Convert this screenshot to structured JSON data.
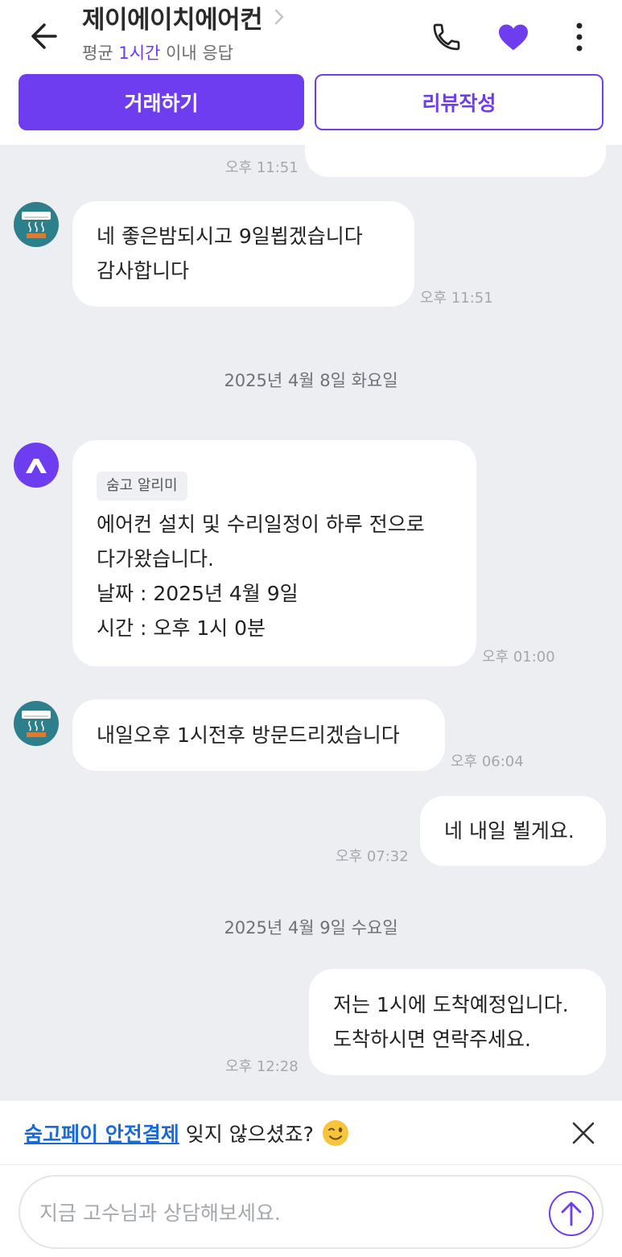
{
  "header": {
    "title": "제이에이치에어컨",
    "subtitle_prefix": "평균 ",
    "subtitle_accent": "1시간",
    "subtitle_suffix": " 이내 응답",
    "deal_button": "거래하기",
    "review_button": "리뷰작성"
  },
  "colors": {
    "accent": "#6f3df0",
    "link": "#1a6ad6",
    "chat_background": "#eceef1"
  },
  "icons": {
    "back": "back-arrow-icon",
    "chevron": "chevron-right-icon",
    "phone": "phone-icon",
    "favorite": "heart-icon",
    "more": "more-vertical-icon",
    "close": "close-icon",
    "send": "send-arrow-icon"
  },
  "messages": {
    "m0": {
      "time": "오후 11:51"
    },
    "m1": {
      "lines": [
        "네 좋은밤되시고 9일뵙겠습니다",
        "감사합니다"
      ],
      "time": "오후 11:51"
    },
    "date1": "2025년 4월 8일 화요일",
    "m2": {
      "tag": "숨고 알리미",
      "lines": [
        "에어컨 설치 및 수리일정이 하루 전으로",
        "다가왔습니다.",
        "날짜 : 2025년 4월 9일",
        "시간 : 오후 1시 0분"
      ],
      "time": "오후 01:00"
    },
    "m3": {
      "lines": [
        "내일오후 1시전후 방문드리겠습니다"
      ],
      "time": "오후 06:04"
    },
    "m4": {
      "lines": [
        "네 내일 뵐게요."
      ],
      "time": "오후 07:32"
    },
    "date2": "2025년 4월 9일 수요일",
    "m5": {
      "lines": [
        "저는 1시에 도착예정입니다.",
        "도착하시면 연락주세요."
      ],
      "time": "오후 12:28"
    }
  },
  "banner": {
    "link": "숨고페이 안전결제",
    "text": "잊지 않으셨죠?"
  },
  "input": {
    "placeholder": "지금 고수님과 상담해보세요.",
    "value": ""
  }
}
